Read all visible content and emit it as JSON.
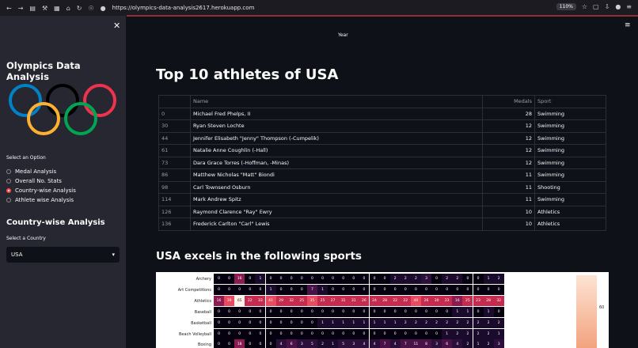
{
  "browser": {
    "url": "https://olympics-data-analysis2617.herokuapp.com",
    "zoom": "110%"
  },
  "sidebar": {
    "title": "Olympics Data Analysis",
    "option_label": "Select an Option",
    "options": [
      "Medal Analysis",
      "Overall No. Stats",
      "Country-wise Analysis",
      "Athlete wise Analysis"
    ],
    "selected_index": 2,
    "section_title": "Country-wise Analysis",
    "country_label": "Select a Country",
    "country_value": "USA"
  },
  "main": {
    "axis_label": "Year",
    "title": "Top 10 athletes of USA",
    "table": {
      "headers": [
        "",
        "Name",
        "Medals",
        "Sport"
      ],
      "rows": [
        [
          "0",
          "Michael Fred Phelps, II",
          "28",
          "Swimming"
        ],
        [
          "30",
          "Ryan Steven Lochte",
          "12",
          "Swimming"
        ],
        [
          "44",
          "Jennifer Elisabeth \"Jenny\" Thompson (-Cumpelik)",
          "12",
          "Swimming"
        ],
        [
          "61",
          "Natalie Anne Coughlin (-Hall)",
          "12",
          "Swimming"
        ],
        [
          "73",
          "Dara Grace Torres (-Hoffman, -Minas)",
          "12",
          "Swimming"
        ],
        [
          "86",
          "Matthew Nicholas \"Matt\" Biondi",
          "11",
          "Swimming"
        ],
        [
          "98",
          "Carl Townsend Osburn",
          "11",
          "Shooting"
        ],
        [
          "114",
          "Mark Andrew Spitz",
          "11",
          "Swimming"
        ],
        [
          "126",
          "Raymond Clarence \"Ray\" Ewry",
          "10",
          "Athletics"
        ],
        [
          "136",
          "Frederick Carlton \"Carl\" Lewis",
          "10",
          "Athletics"
        ]
      ]
    },
    "subtitle": "USA excels in the following sports"
  },
  "chart_data": {
    "type": "heatmap",
    "rows": [
      "Archery",
      "Art Competitions",
      "Athletics",
      "Baseball",
      "Basketball",
      "Beach Volleyball",
      "Boxing"
    ],
    "values": [
      [
        0,
        0,
        16,
        0,
        1,
        0,
        0,
        0,
        0,
        0,
        0,
        0,
        0,
        0,
        0,
        0,
        0,
        2,
        2,
        2,
        3,
        0,
        2,
        2,
        0,
        0,
        1,
        2
      ],
      [
        0,
        0,
        0,
        0,
        0,
        1,
        0,
        0,
        0,
        7,
        1,
        0,
        0,
        0,
        0,
        0,
        0,
        0,
        0,
        0,
        0,
        0,
        0,
        0,
        0,
        0,
        0,
        0
      ],
      [
        16,
        39,
        65,
        22,
        33,
        41,
        29,
        32,
        25,
        35,
        25,
        27,
        31,
        31,
        26,
        24,
        28,
        22,
        22,
        40,
        26,
        30,
        23,
        16,
        25,
        23,
        28,
        32
      ],
      [
        0,
        0,
        0,
        0,
        0,
        0,
        0,
        0,
        0,
        0,
        0,
        0,
        0,
        0,
        0,
        0,
        0,
        0,
        0,
        0,
        0,
        0,
        0,
        1,
        1,
        0,
        1,
        0
      ],
      [
        0,
        0,
        0,
        0,
        0,
        0,
        0,
        0,
        0,
        0,
        1,
        1,
        1,
        1,
        1,
        1,
        1,
        1,
        2,
        2,
        2,
        2,
        2,
        2,
        2,
        2,
        2,
        2
      ],
      [
        0,
        0,
        0,
        0,
        0,
        0,
        0,
        0,
        0,
        0,
        0,
        0,
        0,
        0,
        0,
        0,
        0,
        0,
        0,
        0,
        0,
        0,
        1,
        2,
        2,
        2,
        2,
        1
      ],
      [
        0,
        0,
        18,
        0,
        0,
        0,
        4,
        6,
        3,
        5,
        2,
        1,
        5,
        3,
        4,
        4,
        7,
        4,
        7,
        11,
        8,
        3,
        6,
        4,
        2,
        1,
        2,
        3
      ]
    ],
    "colorbar_tick": "60"
  }
}
